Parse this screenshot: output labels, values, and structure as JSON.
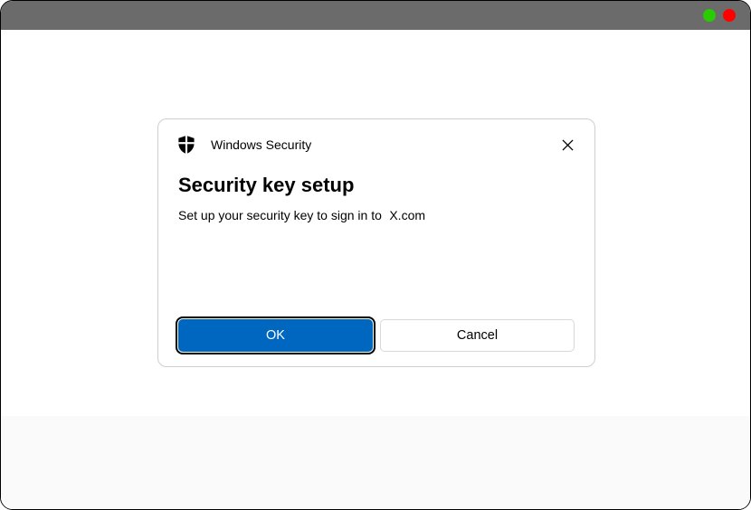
{
  "titlebar": {
    "dot_green": "minimize",
    "dot_red": "close"
  },
  "dialog": {
    "app_name": "Windows Security",
    "title": "Security key setup",
    "message": "Set up your security key to sign in to",
    "site": "X.com",
    "buttons": {
      "ok": "OK",
      "cancel": "Cancel"
    }
  }
}
